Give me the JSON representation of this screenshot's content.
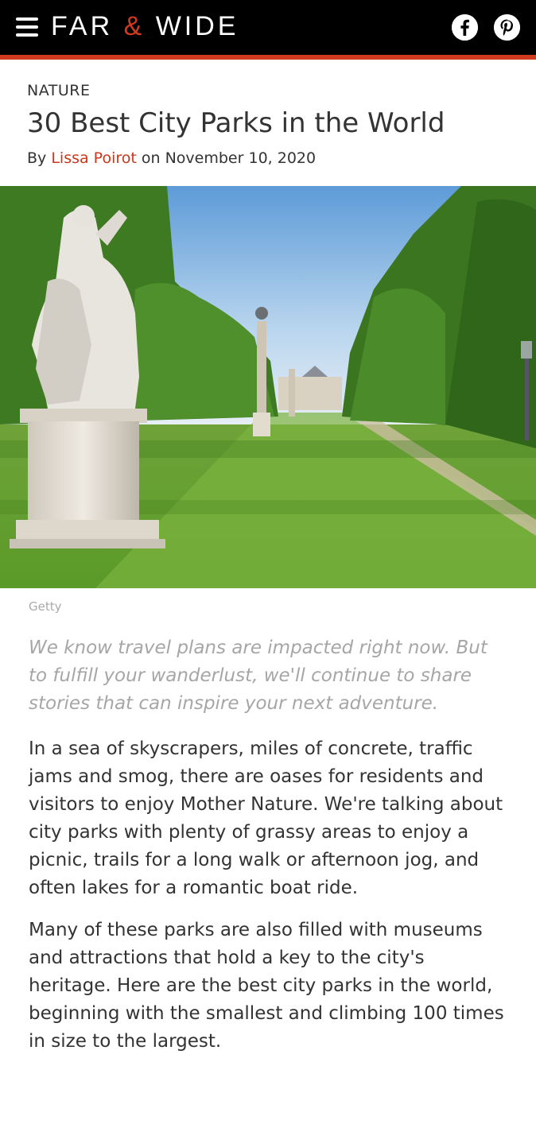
{
  "header": {
    "brand_left": "FAR",
    "brand_amp": "&",
    "brand_right": "WIDE",
    "accent_color": "#d23a1f",
    "icons": [
      "menu-icon",
      "facebook-icon",
      "pinterest-icon"
    ]
  },
  "article": {
    "category": "NATURE",
    "title": "30 Best City Parks in the World",
    "byline_prefix": "By",
    "author": "Lissa Poirot",
    "byline_mid": "on",
    "date": "November 10, 2020",
    "image_credit": "Getty",
    "intro": "We know travel plans are impacted right now. But to fulfill your wanderlust, we'll continue to share stories that can inspire your next adventure.",
    "paragraphs": [
      "In a sea of skyscrapers, miles of concrete, traffic jams and smog, there are oases for residents and visitors to enjoy Mother Nature. We're talking about city parks with plenty of grassy areas to enjoy a picnic, trails for a long walk or afternoon jog, and often lakes for a romantic boat ride.",
      "Many of these parks are also filled with museums and attractions that hold a key to the city's heritage. Here are the best city parks in the world, beginning with the smallest and climbing 100 times in size to the largest."
    ]
  }
}
